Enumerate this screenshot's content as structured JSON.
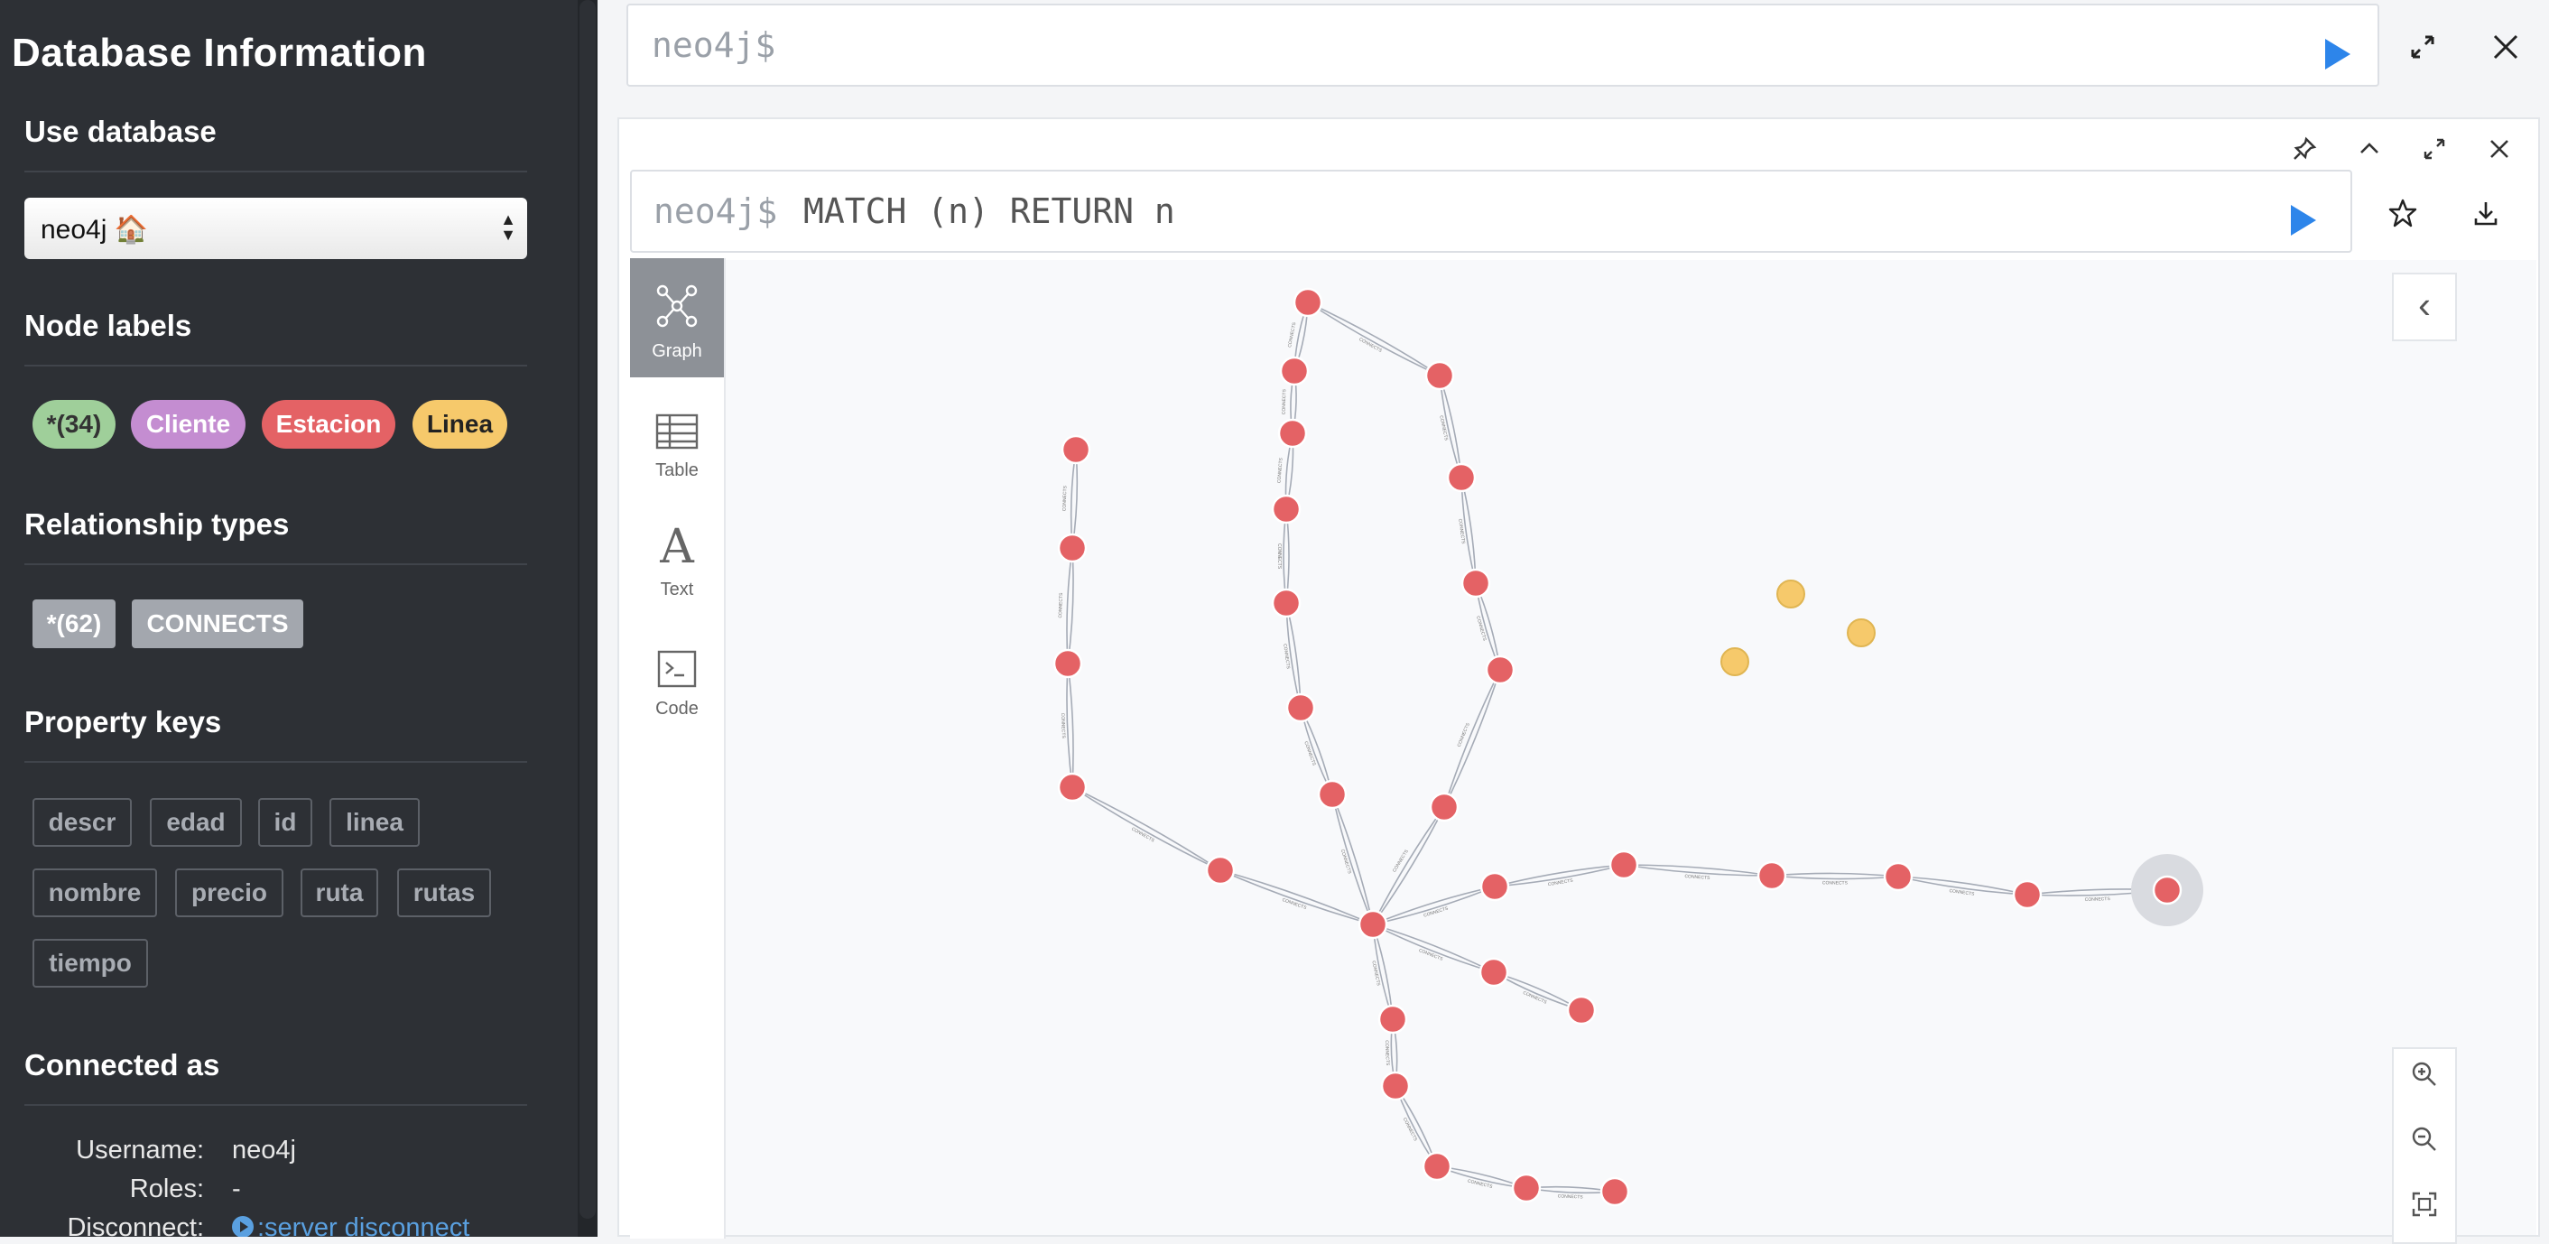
{
  "sidebar": {
    "title": "Database Information",
    "use_database": {
      "heading": "Use database",
      "selected": "neo4j 🏠"
    },
    "node_labels": {
      "heading": "Node labels",
      "items": [
        {
          "label": "*(34)",
          "color": "#9fcf9a"
        },
        {
          "label": "Cliente",
          "color": "#c48dd1"
        },
        {
          "label": "Estacion",
          "color": "#e46265"
        },
        {
          "label": "Linea",
          "color": "#f6c96b"
        }
      ]
    },
    "relationship_types": {
      "heading": "Relationship types",
      "items": [
        "*(62)",
        "CONNECTS"
      ]
    },
    "property_keys": {
      "heading": "Property keys",
      "items": [
        "descr",
        "edad",
        "id",
        "linea",
        "nombre",
        "precio",
        "ruta",
        "rutas",
        "tiempo"
      ]
    },
    "connected_as": {
      "heading": "Connected as",
      "username_label": "Username:",
      "username": "neo4j",
      "roles_label": "Roles:",
      "roles": "-",
      "disconnect_label": "Disconnect:",
      "disconnect_link": ":server disconnect"
    }
  },
  "top_editor": {
    "prompt": "neo4j$"
  },
  "frame": {
    "prompt": "neo4j$",
    "query": "MATCH (n) RETURN n",
    "tabs": [
      "Graph",
      "Table",
      "Text",
      "Code"
    ],
    "active_tab": "Graph"
  },
  "graph": {
    "node_color": "#e46265",
    "linea_color": "#f6c96b",
    "edge_label": "CONNECTS"
  }
}
